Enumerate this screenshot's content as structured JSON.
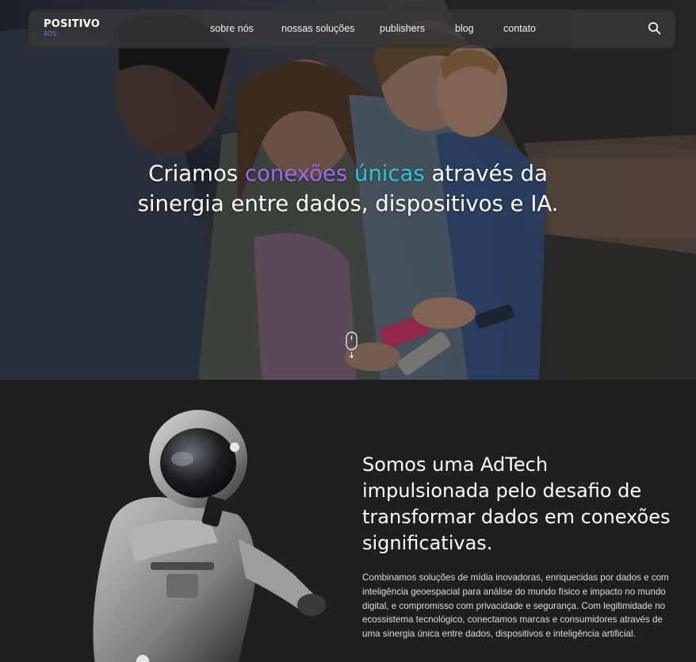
{
  "brand": {
    "name": "POSITIVO",
    "sub": "ADS"
  },
  "nav": {
    "items": [
      {
        "label": "sobre nós"
      },
      {
        "label": "nossas soluções"
      },
      {
        "label": "publishers"
      },
      {
        "label": "blog"
      },
      {
        "label": "contato"
      }
    ],
    "search_icon": "search-icon"
  },
  "hero": {
    "headline": {
      "part1": "Criamos ",
      "highlight1": "conexões",
      "space": " ",
      "highlight2": "únicas",
      "part2": " através da",
      "line2": "sinergia entre dados, dispositivos e IA."
    },
    "scroll_icon": "mouse-scroll-icon"
  },
  "about": {
    "title": "Somos uma AdTech impulsionada pelo desafio de transformar dados em conexões significativas.",
    "body": "Combinamos soluções de mídia inovadoras, enriquecidas por dados e com inteligência geoespacial para análise do mundo físico e impacto no mundo digital, e compromisso com privacidade e segurança. Com legitimidade no ecossistema tecnológico, conectamos marcas e consumidores através de uma sinergia única entre dados, dispositivos e inteligência artificial."
  },
  "colors": {
    "accent_purple": "#9a6bf0",
    "accent_cyan": "#26c6d6",
    "section_bg": "#1e1f21",
    "nav_bg": "#37373a"
  }
}
